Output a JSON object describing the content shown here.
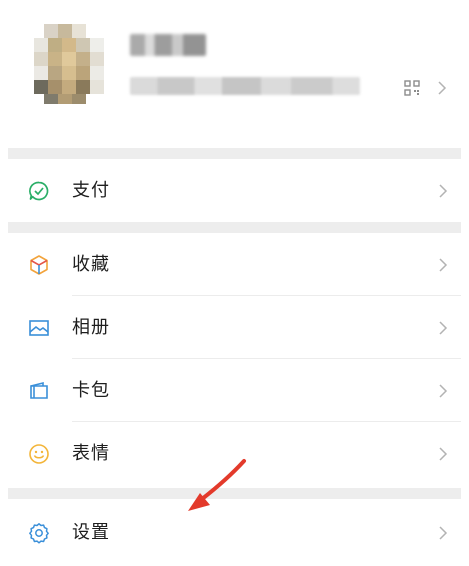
{
  "profile": {
    "avatar_icon": "user-avatar-blurred",
    "qr_icon": "qr-code-icon",
    "chevron_icon": "chevron-right-icon"
  },
  "menu": [
    {
      "label": "支付",
      "icon": "pay-icon",
      "color": "#2aae67"
    },
    {
      "label": "收藏",
      "icon": "favorites-cube-icon",
      "color": "#f2a33b"
    },
    {
      "label": "相册",
      "icon": "album-icon",
      "color": "#3a8fd9"
    },
    {
      "label": "卡包",
      "icon": "card-wallet-icon",
      "color": "#3a8fd9"
    },
    {
      "label": "表情",
      "icon": "sticker-smile-icon",
      "color": "#f3b53a"
    },
    {
      "label": "设置",
      "icon": "settings-gear-icon",
      "color": "#3a8fd9"
    }
  ],
  "annotation": {
    "arrow_color": "#e33a2b",
    "icon": "red-pointer-arrow"
  }
}
